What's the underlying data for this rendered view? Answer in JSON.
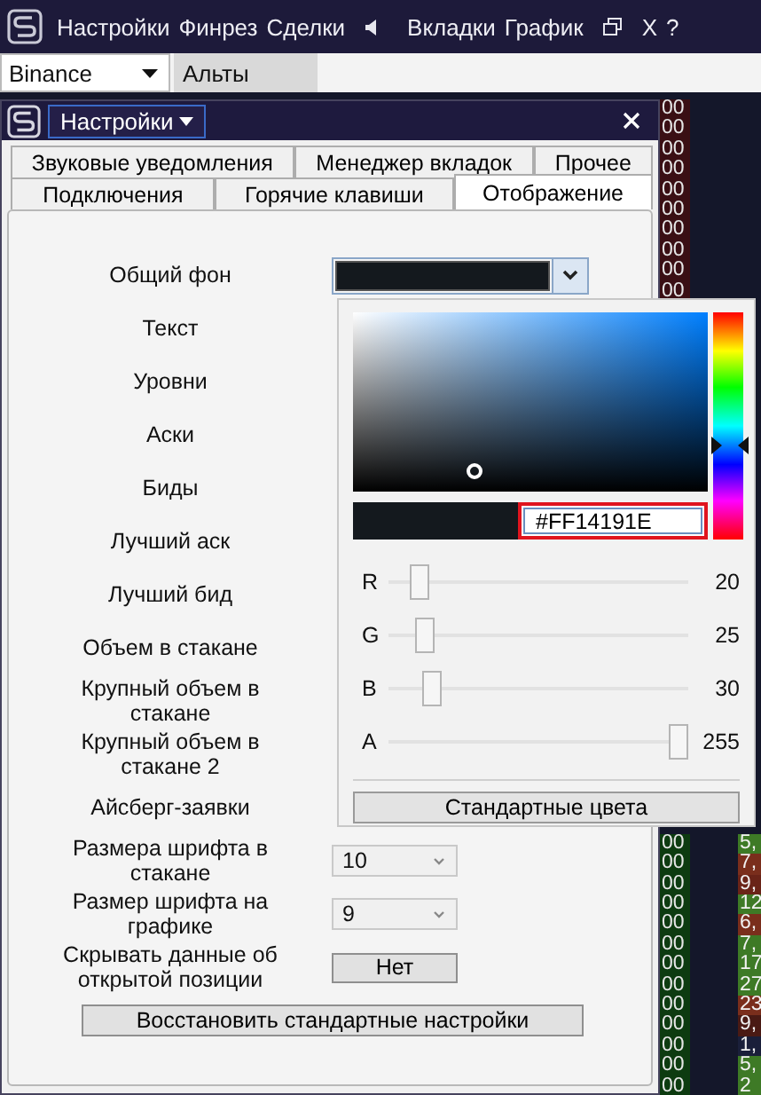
{
  "menu_bar": {
    "items": [
      {
        "kind": "text",
        "label": "Настройки"
      },
      {
        "kind": "text",
        "label": "Финрез"
      },
      {
        "kind": "text",
        "label": "Сделки"
      },
      {
        "kind": "speaker"
      },
      {
        "kind": "text",
        "label": "Вкладки"
      },
      {
        "kind": "text",
        "label": "График"
      },
      {
        "kind": "restore"
      },
      {
        "kind": "text",
        "label": "X"
      },
      {
        "kind": "text",
        "label": "?"
      }
    ]
  },
  "tab_strip": {
    "exchange": "Binance",
    "tabs": [
      {
        "label": "Альты"
      }
    ]
  },
  "dialog": {
    "title": "Настройки",
    "tab_rows": [
      [
        {
          "label": "Звуковые уведомления",
          "selected": false
        },
        {
          "label": "Менеджер вкладок",
          "selected": false
        },
        {
          "label": "Прочее",
          "selected": false
        }
      ],
      [
        {
          "label": "Подключения",
          "selected": false
        },
        {
          "label": "Горячие клавиши",
          "selected": false
        },
        {
          "label": "Отображение",
          "selected": true
        }
      ]
    ],
    "settings": [
      {
        "label": "Общий фон",
        "kind": "color",
        "color": "#14191e"
      },
      {
        "label": "Текст",
        "kind": "label"
      },
      {
        "label": "Уровни",
        "kind": "label"
      },
      {
        "label": "Аски",
        "kind": "label"
      },
      {
        "label": "Биды",
        "kind": "label"
      },
      {
        "label": "Лучший аск",
        "kind": "label"
      },
      {
        "label": "Лучший бид",
        "kind": "label"
      },
      {
        "label": "Объем в стакане",
        "kind": "label"
      },
      {
        "label": "Крупный объем в стакане",
        "kind": "label"
      },
      {
        "label": "Крупный объем в стакане 2",
        "kind": "label"
      },
      {
        "label": "Айсберг-заявки",
        "kind": "label"
      },
      {
        "label": "Размера шрифта в стакане",
        "kind": "select",
        "value": "10"
      },
      {
        "label": "Размер шрифта на графике",
        "kind": "select",
        "value": "9"
      },
      {
        "label": "Скрывать данные об открытой позиции",
        "kind": "button",
        "value": "Нет"
      }
    ],
    "reset_button": "Восстановить стандартные настройки"
  },
  "color_picker": {
    "hex": "#FF14191E",
    "channels": [
      {
        "name": "R",
        "level": 0.078,
        "reading": "20"
      },
      {
        "name": "G",
        "level": 0.098,
        "reading": "25"
      },
      {
        "name": "B",
        "level": 0.118,
        "reading": "30"
      },
      {
        "name": "A",
        "level": 1,
        "reading": "255"
      }
    ],
    "standard_button": "Стандартные цвета"
  },
  "order_book": {
    "rows_top": [
      {
        "qty": "00"
      },
      {
        "qty": "00"
      },
      {
        "qty": "00"
      },
      {
        "qty": "00"
      },
      {
        "qty": "00"
      },
      {
        "qty": "00"
      },
      {
        "qty": "00"
      },
      {
        "qty": "00"
      },
      {
        "qty": "00"
      },
      {
        "qty": "00"
      }
    ],
    "rows_bottom": [
      {
        "qty": "00",
        "price": "5,",
        "color": "#3e7a26"
      },
      {
        "qty": "00",
        "price": "7,",
        "color": "#7a2e1c"
      },
      {
        "qty": "00",
        "price": "9,",
        "color": "#6a2418"
      },
      {
        "qty": "00",
        "price": "12",
        "color": "#3e7a26"
      },
      {
        "qty": "00",
        "price": "6,",
        "color": "#7a2e1c"
      },
      {
        "qty": "00",
        "price": "7,",
        "color": "#3e7a26"
      },
      {
        "qty": "00",
        "price": "17",
        "color": "#3e7a26"
      },
      {
        "qty": "00",
        "price": "27",
        "color": "#3e7a26"
      },
      {
        "qty": "00",
        "price": "23",
        "color": "#7a2e1c"
      },
      {
        "qty": "00",
        "price": "9,",
        "color": "#4a1a14"
      },
      {
        "qty": "00",
        "price": "1,",
        "color": "#1a1f3a"
      },
      {
        "qty": "00",
        "price": "5,",
        "color": "#3e7a26"
      },
      {
        "qty": "00",
        "price": "2",
        "color": "#3e7a26"
      }
    ]
  }
}
